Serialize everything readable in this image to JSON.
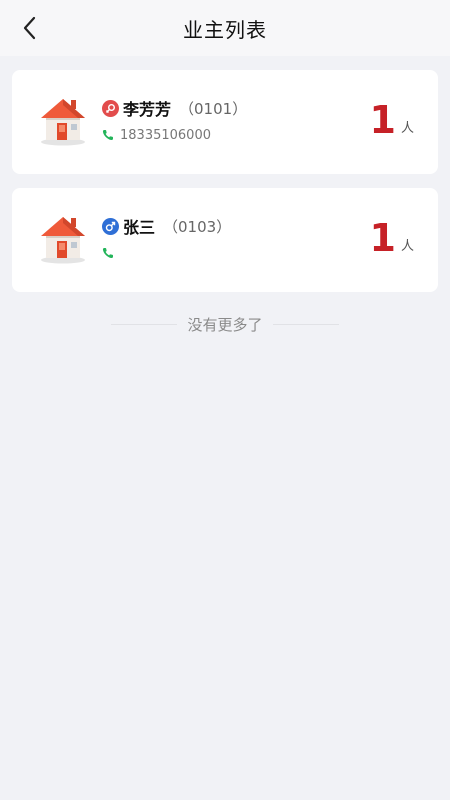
{
  "header": {
    "title": "业主列表",
    "back_icon": "chevron-left-icon"
  },
  "owners": [
    {
      "name": "李芳芳",
      "room": "（0101）",
      "phone": "18335106000",
      "gender": "female",
      "gender_color": "#e24c4c",
      "count": "1",
      "unit": "人"
    },
    {
      "name": "张三",
      "room": "（0103）",
      "phone": "",
      "gender": "male",
      "gender_color": "#2f6fd6",
      "count": "1",
      "unit": "人"
    }
  ],
  "footer": {
    "no_more": "没有更多了"
  },
  "colors": {
    "accent": "#c62127",
    "phone_icon": "#23b45a"
  }
}
